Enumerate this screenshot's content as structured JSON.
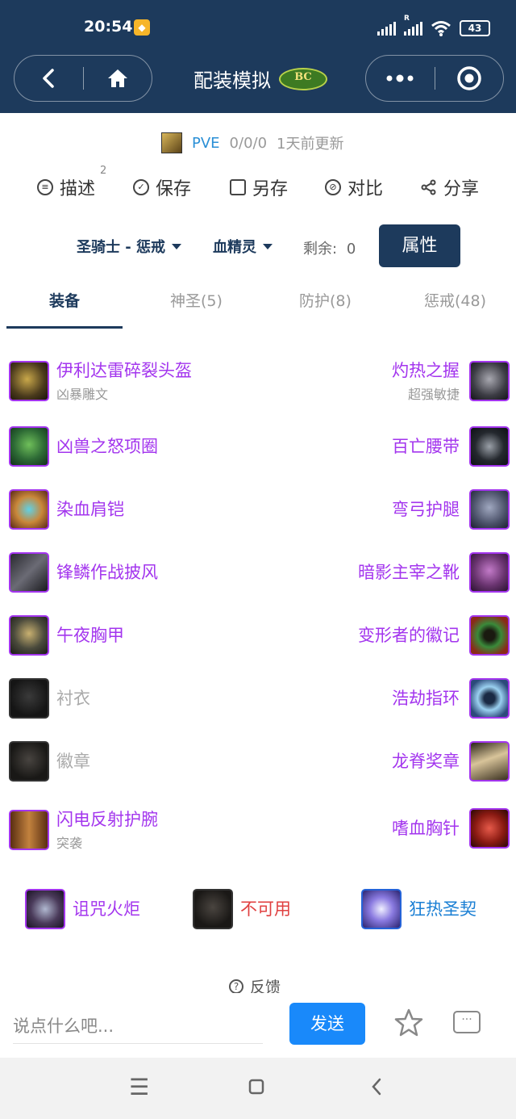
{
  "status": {
    "time": "20:54",
    "battery": "43",
    "roaming_mark": "R"
  },
  "header": {
    "title": "配装模拟",
    "logo_text": "BC"
  },
  "meta": {
    "mode": "PVE",
    "score": "0/0/0",
    "updated": "1天前更新"
  },
  "actions": [
    {
      "label": "描述",
      "icon": "list-icon"
    },
    {
      "label": "保存",
      "icon": "check-circle-icon"
    },
    {
      "label": "另存",
      "icon": "folder-icon"
    },
    {
      "label": "对比",
      "icon": "compare-icon"
    },
    {
      "label": "分享",
      "icon": "share-icon"
    }
  ],
  "description_count": "2",
  "selectors": {
    "spec": "圣骑士 - 惩戒",
    "race": "血精灵",
    "remaining_label": "剩余:",
    "remaining_value": "0",
    "attr_button": "属性"
  },
  "tabs": [
    {
      "label": "装备",
      "active": true
    },
    {
      "label": "神圣(5)"
    },
    {
      "label": "防护(8)"
    },
    {
      "label": "惩戒(48)"
    }
  ],
  "gear_left": [
    {
      "name": "伊利达雷碎裂头盔",
      "sub": "凶暴雕文",
      "quality": "epic"
    },
    {
      "name": "凶兽之怒项圈",
      "sub": "",
      "quality": "epic"
    },
    {
      "name": "染血肩铠",
      "sub": "",
      "quality": "epic"
    },
    {
      "name": "锋鳞作战披风",
      "sub": "",
      "quality": "epic"
    },
    {
      "name": "午夜胸甲",
      "sub": "",
      "quality": "epic"
    },
    {
      "name": "衬衣",
      "sub": "",
      "quality": "empty"
    },
    {
      "name": "徽章",
      "sub": "",
      "quality": "empty"
    },
    {
      "name": "闪电反射护腕",
      "sub": "突袭",
      "quality": "epic"
    }
  ],
  "gear_right": [
    {
      "name": "灼热之握",
      "sub": "超强敏捷",
      "quality": "epic"
    },
    {
      "name": "百亡腰带",
      "sub": "",
      "quality": "epic"
    },
    {
      "name": "弯弓护腿",
      "sub": "",
      "quality": "epic"
    },
    {
      "name": "暗影主宰之靴",
      "sub": "",
      "quality": "epic"
    },
    {
      "name": "变形者的徽记",
      "sub": "",
      "quality": "epic"
    },
    {
      "name": "浩劫指环",
      "sub": "",
      "quality": "epic"
    },
    {
      "name": "龙脊奖章",
      "sub": "",
      "quality": "epic"
    },
    {
      "name": "嗜血胸针",
      "sub": "",
      "quality": "epic"
    }
  ],
  "weapons": [
    {
      "name": "诅咒火炬",
      "quality": "epic"
    },
    {
      "name": "不可用",
      "quality": "unavailable"
    },
    {
      "name": "狂热圣契",
      "quality": "rare"
    }
  ],
  "feedback": "反馈",
  "comment": {
    "placeholder": "说点什么吧...",
    "send": "发送"
  },
  "colors": {
    "header_bg": "#1d3a5c",
    "epic": "#a335ee",
    "rare_text": "#1a7fd4",
    "unavailable": "#e04040",
    "send_button": "#1989fa"
  }
}
